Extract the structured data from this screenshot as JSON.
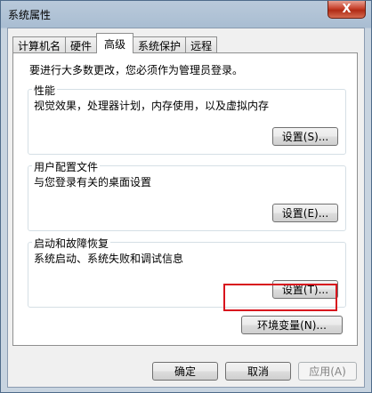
{
  "window": {
    "title": "系统属性",
    "close_label": "X"
  },
  "tabs": [
    {
      "label": "计算机名"
    },
    {
      "label": "硬件"
    },
    {
      "label": "高级",
      "active": true
    },
    {
      "label": "系统保护"
    },
    {
      "label": "远程"
    }
  ],
  "panel": {
    "note": "要进行大多数更改，您必须作为管理员登录。",
    "performance": {
      "title": "性能",
      "desc": "视觉效果，处理器计划，内存使用，以及虚拟内存",
      "button": "设置(S)..."
    },
    "user_profiles": {
      "title": "用户配置文件",
      "desc": "与您登录有关的桌面设置",
      "button": "设置(E)..."
    },
    "startup": {
      "title": "启动和故障恢复",
      "desc": "系统启动、系统失败和调试信息",
      "button": "设置(T)..."
    },
    "env_button": "环境变量(N)..."
  },
  "footer": {
    "ok": "确定",
    "cancel": "取消",
    "apply": "应用(A)"
  },
  "colors": {
    "highlight": "#d8141d",
    "close": "#c7402b"
  }
}
